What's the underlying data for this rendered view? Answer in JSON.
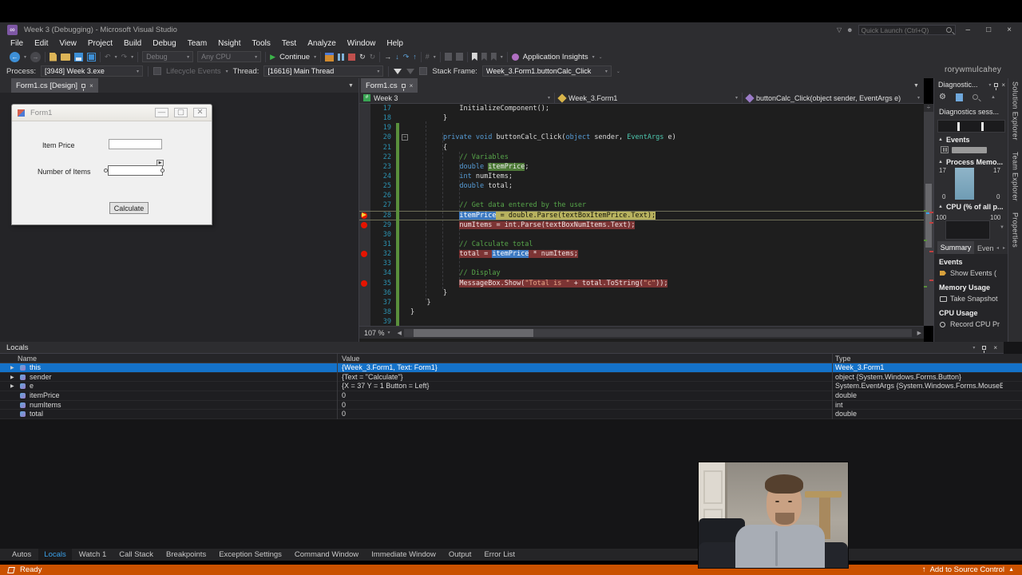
{
  "window": {
    "title": "Week 3 (Debugging) - Microsoft Visual Studio",
    "quick_launch": "Quick Launch (Ctrl+Q)",
    "watermark": "rorywmulcahey"
  },
  "menu": {
    "items": [
      "File",
      "Edit",
      "View",
      "Project",
      "Build",
      "Debug",
      "Team",
      "Nsight",
      "Tools",
      "Test",
      "Analyze",
      "Window",
      "Help"
    ]
  },
  "toolbar": {
    "config": "Debug",
    "platform": "Any CPU",
    "continue_label": "Continue",
    "app_insights": "Application Insights"
  },
  "debug_bar": {
    "process_label": "Process:",
    "process": "[3948] Week 3.exe",
    "lifecycle": "Lifecycle Events",
    "thread_label": "Thread:",
    "thread": "[16616] Main Thread",
    "stack_label": "Stack Frame:",
    "stack": "Week_3.Form1.buttonCalc_Click"
  },
  "designer": {
    "tab": "Form1.cs [Design]",
    "form_title": "Form1",
    "item_price_label": "Item Price",
    "num_items_label": "Number of Items",
    "calc_button": "Calculate"
  },
  "editor": {
    "tab": "Form1.cs",
    "nav_project": "Week 3",
    "nav_class": "Week_3.Form1",
    "nav_method": "buttonCalc_Click(object sender, EventArgs e)",
    "zoom": "107 %",
    "lines": [
      {
        "n": "17",
        "s": [
          [
            "            InitializeComponent();",
            "pl"
          ]
        ]
      },
      {
        "n": "18",
        "s": [
          [
            "        }",
            "pl"
          ]
        ]
      },
      {
        "n": "19",
        "s": []
      },
      {
        "n": "20",
        "fold": true,
        "s": [
          [
            "        ",
            "pl"
          ],
          [
            "private",
            "kw"
          ],
          [
            " ",
            "pl"
          ],
          [
            "void",
            "kw"
          ],
          [
            " buttonCalc_Click(",
            "pl"
          ],
          [
            "object",
            "kw"
          ],
          [
            " sender, ",
            "pl"
          ],
          [
            "EventArgs",
            "ty"
          ],
          [
            " e)",
            "pl"
          ]
        ]
      },
      {
        "n": "21",
        "s": [
          [
            "        {",
            "pl"
          ]
        ]
      },
      {
        "n": "22",
        "s": [
          [
            "            ",
            "pl"
          ],
          [
            "// Variables",
            "cm"
          ]
        ]
      },
      {
        "n": "23",
        "s": [
          [
            "            ",
            "pl"
          ],
          [
            "double",
            "kw"
          ],
          [
            " ",
            "pl"
          ],
          [
            "itemPrice",
            "ref"
          ],
          [
            ";",
            "pl"
          ]
        ]
      },
      {
        "n": "24",
        "s": [
          [
            "            ",
            "pl"
          ],
          [
            "int",
            "kw"
          ],
          [
            " numItems;",
            "pl"
          ]
        ]
      },
      {
        "n": "25",
        "s": [
          [
            "            ",
            "pl"
          ],
          [
            "double",
            "kw"
          ],
          [
            " total;",
            "pl"
          ]
        ]
      },
      {
        "n": "26",
        "s": []
      },
      {
        "n": "27",
        "s": [
          [
            "            ",
            "pl"
          ],
          [
            "// Get data entered by the user",
            "cm"
          ]
        ]
      },
      {
        "n": "28",
        "g": "cur",
        "s": [
          [
            "            ",
            "pl"
          ],
          [
            "itemPrice",
            "sel"
          ],
          [
            " = double.Parse(textBoxItemPrice.Text);",
            "cur"
          ]
        ]
      },
      {
        "n": "29",
        "g": "bp",
        "s": [
          [
            "            ",
            "pl"
          ],
          [
            "numItems = int.Parse(textBoxNumItems.Text);",
            "bp"
          ]
        ]
      },
      {
        "n": "30",
        "s": []
      },
      {
        "n": "31",
        "s": [
          [
            "            ",
            "pl"
          ],
          [
            "// Calculate total",
            "cm"
          ]
        ]
      },
      {
        "n": "32",
        "g": "bp",
        "s": [
          [
            "            ",
            "pl"
          ],
          [
            "total = ",
            "bp"
          ],
          [
            "itemPrice",
            "sel"
          ],
          [
            " * numItems;",
            "bp"
          ]
        ]
      },
      {
        "n": "33",
        "s": []
      },
      {
        "n": "34",
        "s": [
          [
            "            ",
            "pl"
          ],
          [
            "// Display",
            "cm"
          ]
        ]
      },
      {
        "n": "35",
        "g": "bp",
        "s": [
          [
            "            ",
            "pl"
          ],
          [
            "MessageBox.Show(",
            "bp"
          ],
          [
            "\"Total is \"",
            "bpstr"
          ],
          [
            " + total.ToString(",
            "bp"
          ],
          [
            "\"c\"",
            "bpstr"
          ],
          [
            "));",
            "bp"
          ]
        ]
      },
      {
        "n": "36",
        "s": [
          [
            "        }",
            "pl"
          ]
        ]
      },
      {
        "n": "37",
        "s": [
          [
            "    }",
            "pl"
          ]
        ]
      },
      {
        "n": "38",
        "s": [
          [
            "}",
            "pl"
          ]
        ]
      },
      {
        "n": "39",
        "s": []
      }
    ]
  },
  "locals": {
    "title": "Locals",
    "columns": [
      "Name",
      "Value",
      "Type"
    ],
    "rows": [
      {
        "expand": true,
        "name": "this",
        "value": "{Week_3.Form1, Text: Form1}",
        "type": "Week_3.Form1",
        "selected": true
      },
      {
        "expand": true,
        "name": "sender",
        "value": "{Text = \"Calculate\"}",
        "type": "object {System.Windows.Forms.Button}",
        "selected": false
      },
      {
        "expand": true,
        "name": "e",
        "value": "{X = 37 Y = 1 Button = Left}",
        "type": "System.EventArgs {System.Windows.Forms.MouseEvent...",
        "selected": false
      },
      {
        "expand": false,
        "name": "itemPrice",
        "value": "0",
        "type": "double",
        "selected": false
      },
      {
        "expand": false,
        "name": "numItems",
        "value": "0",
        "type": "int",
        "selected": false
      },
      {
        "expand": false,
        "name": "total",
        "value": "0",
        "type": "double",
        "selected": false
      }
    ]
  },
  "panel_tabs": {
    "items": [
      "Autos",
      "Locals",
      "Watch 1",
      "Call Stack",
      "Breakpoints",
      "Exception Settings",
      "Command Window",
      "Immediate Window",
      "Output",
      "Error List"
    ],
    "active": "Locals"
  },
  "status": {
    "ready": "Ready",
    "source_control": "Add to Source Control"
  },
  "diagnostics": {
    "title": "Diagnostic...",
    "session": "Diagnostics sess...",
    "events_header": "Events",
    "memory_header": "Process Memo...",
    "memory_top_left": "17",
    "memory_top_right": "17",
    "memory_bottom_left": "0",
    "memory_bottom_right": "0",
    "cpu_header": "CPU (% of all p...",
    "cpu_left": "100",
    "cpu_right": "100",
    "tab_summary": "Summary",
    "tab_events": "Even",
    "summary_events_title": "Events",
    "show_events": "Show Events (",
    "memory_usage_title": "Memory Usage",
    "take_snapshot": "Take Snapshot",
    "cpu_usage_title": "CPU Usage",
    "record_cpu": "Record CPU Pr"
  },
  "side_tabs": {
    "items": [
      "Solution Explorer",
      "Team Explorer",
      "Properties"
    ]
  },
  "colors": {
    "accent_blue": "#007acc",
    "status_orange": "#ca5100",
    "breakpoint_red": "#e51400",
    "selection_blue": "#3d7ac2",
    "current_stmt": "#b8b25f",
    "bp_line": "#7c3434"
  }
}
